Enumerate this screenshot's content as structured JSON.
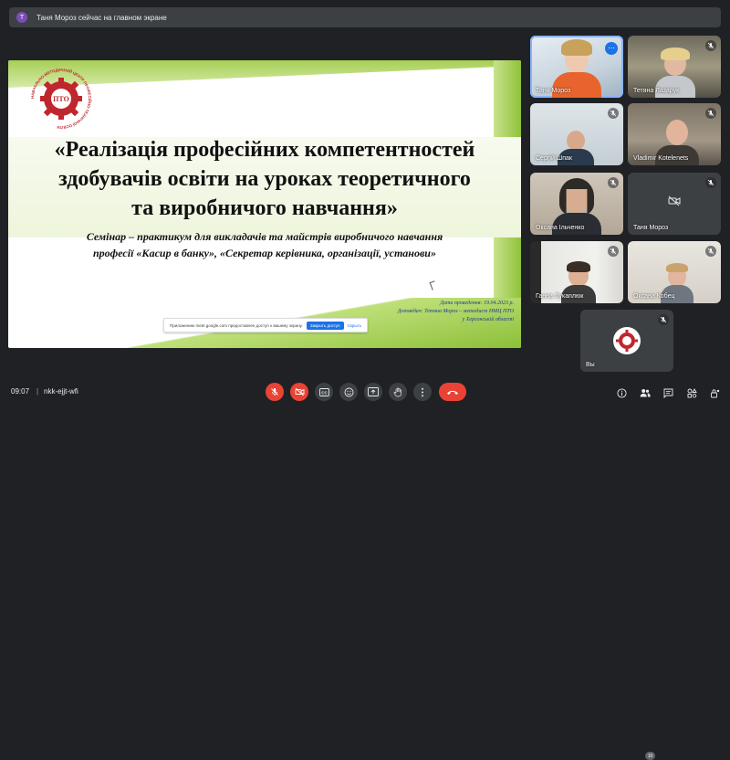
{
  "banner": {
    "avatar_letter": "Т",
    "text": "Таня Мороз сейчас на главном экране"
  },
  "slide": {
    "logo_ring_text": "НАВЧАЛЬНО-МЕТОДИЧНИЙ ЦЕНТР ПРОФЕСІЙНО-ТЕХНІЧНОЇ ОСВІТИ",
    "logo_center": "ПТО",
    "title_lines": [
      "«Реалізація професійних компетентностей",
      "здобувачів освіти на уроках теоретичного",
      "та виробничого навчання»"
    ],
    "subtitle_lines": [
      "Семінар – практикум для викладачів та майстрів виробничого навчання",
      "професії «Касир в банку», «Секретар керівника, організації, установи»"
    ],
    "credits_lines": [
      "Дата проведення: 19.04.2023 р.",
      "Доповідач: Тетяна Мороз – методист НМЦ ПТО",
      "у Херсонській області"
    ],
    "notice": {
      "text": "Приложению meet.google.com предоставлен доступ к вашему экрану.",
      "stop": "Закрыть доступ",
      "hide": "Скрыть"
    }
  },
  "participants": [
    {
      "name": "Таня Мороз"
    },
    {
      "name": "Тетяна Лазарук"
    },
    {
      "name": "Сергій Шпак"
    },
    {
      "name": "Vladimir Kotelenets"
    },
    {
      "name": "Оксана Ільченко"
    },
    {
      "name": "Таня Мороз"
    },
    {
      "name": "Ганна Лукаплюк"
    },
    {
      "name": "Оксана Кобец"
    },
    {
      "name": "Вы"
    }
  ],
  "bottom": {
    "time": "09:07",
    "separator": "|",
    "meeting_code": "nkk-ejjt-wfi",
    "participant_count": "10"
  },
  "colors": {
    "background": "#202124",
    "tile": "#3c4043",
    "end_call": "#ea4335",
    "accent": "#1a73e8"
  }
}
